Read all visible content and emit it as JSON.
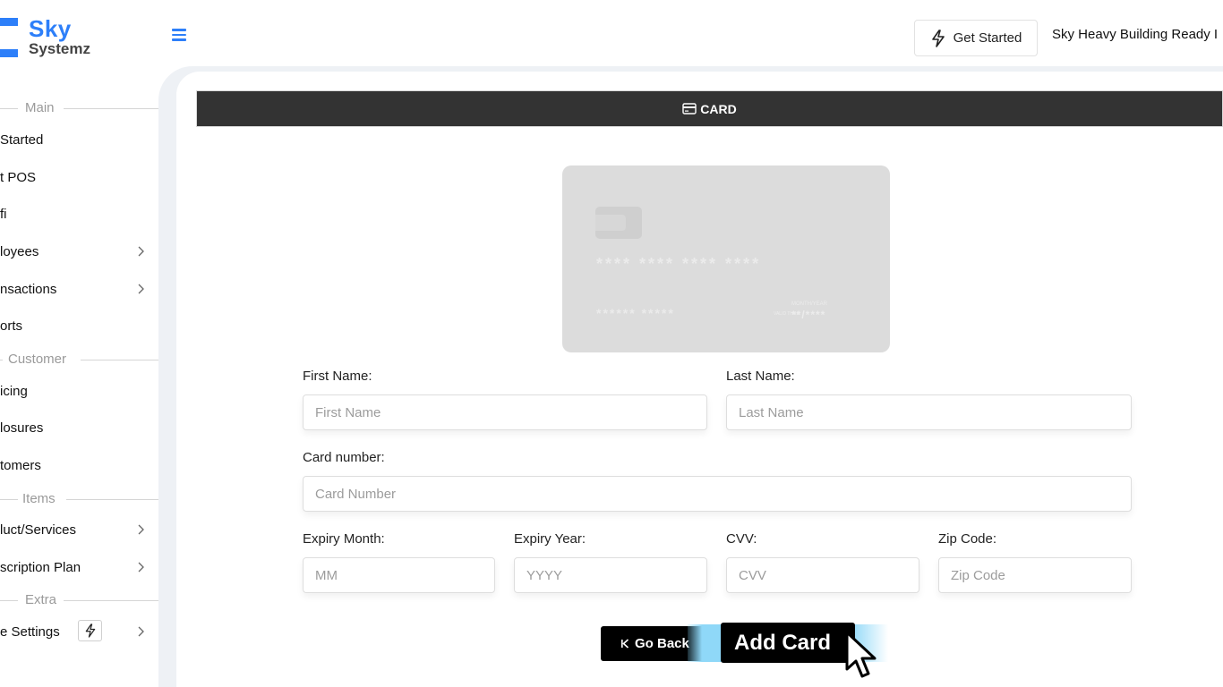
{
  "header": {
    "logo_line1": "Sky",
    "logo_line2": "Systemz",
    "get_started_label": "Get Started",
    "company_name": "Sky Heavy Building Ready I"
  },
  "sidebar": {
    "sections": [
      {
        "label": "Main"
      },
      {
        "label": "Customer"
      },
      {
        "label": "Items"
      },
      {
        "label": "Extra"
      }
    ],
    "items": [
      {
        "label": "Started"
      },
      {
        "label": "t POS"
      },
      {
        "label": "fi"
      },
      {
        "label": "loyees"
      },
      {
        "label": "nsactions"
      },
      {
        "label": "orts"
      },
      {
        "label": "icing"
      },
      {
        "label": "losures"
      },
      {
        "label": "tomers"
      },
      {
        "label": "luct/Services"
      },
      {
        "label": "scription Plan"
      },
      {
        "label": "e Settings"
      }
    ]
  },
  "card_panel": {
    "title": "CARD",
    "preview": {
      "number_mask": "**** **** **** ****",
      "name_mask": "****** *****",
      "valid_label": "VALID THRU",
      "expiry_label": "MONTH/YEAR",
      "expiry_mask": "**/****"
    },
    "form": {
      "first_name": {
        "label": "First Name:",
        "placeholder": "First Name",
        "value": ""
      },
      "last_name": {
        "label": "Last Name:",
        "placeholder": "Last Name",
        "value": ""
      },
      "card_number": {
        "label": "Card number:",
        "placeholder": "Card Number",
        "value": ""
      },
      "expiry_month": {
        "label": "Expiry Month:",
        "placeholder": "MM",
        "value": ""
      },
      "expiry_year": {
        "label": "Expiry Year:",
        "placeholder": "YYYY",
        "value": ""
      },
      "cvv": {
        "label": "CVV:",
        "placeholder": "CVV",
        "value": ""
      },
      "zip": {
        "label": "Zip Code:",
        "placeholder": "Zip Code",
        "value": ""
      }
    },
    "go_back_label": "Go Back",
    "add_card_label": "Add Card"
  },
  "colors": {
    "brand": "#2d7ff9",
    "header_bar": "#333333",
    "button": "#000000",
    "highlight": "#8fd8f8"
  }
}
